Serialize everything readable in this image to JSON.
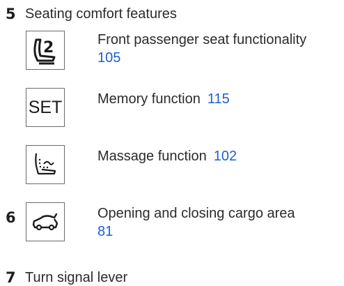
{
  "sections": [
    {
      "number": "5",
      "title": "Seating comfort features",
      "items": [
        {
          "icon": "seat-2-icon",
          "text": "Front passenger seat functionality",
          "page": "105"
        },
        {
          "icon": "set-icon",
          "icon_text": "SET",
          "text": "Memory function",
          "page": "115"
        },
        {
          "icon": "massage-seat-icon",
          "text": "Massage function",
          "page": "102"
        }
      ]
    },
    {
      "number": "6",
      "items": [
        {
          "icon": "car-trunk-icon",
          "text": "Opening and closing cargo area",
          "page": "81"
        }
      ]
    },
    {
      "number": "7",
      "title": "Turn signal lever"
    }
  ],
  "colors": {
    "text": "#2b2b2b",
    "link": "#1a5fd6",
    "icon_border": "#6b6b6b"
  }
}
